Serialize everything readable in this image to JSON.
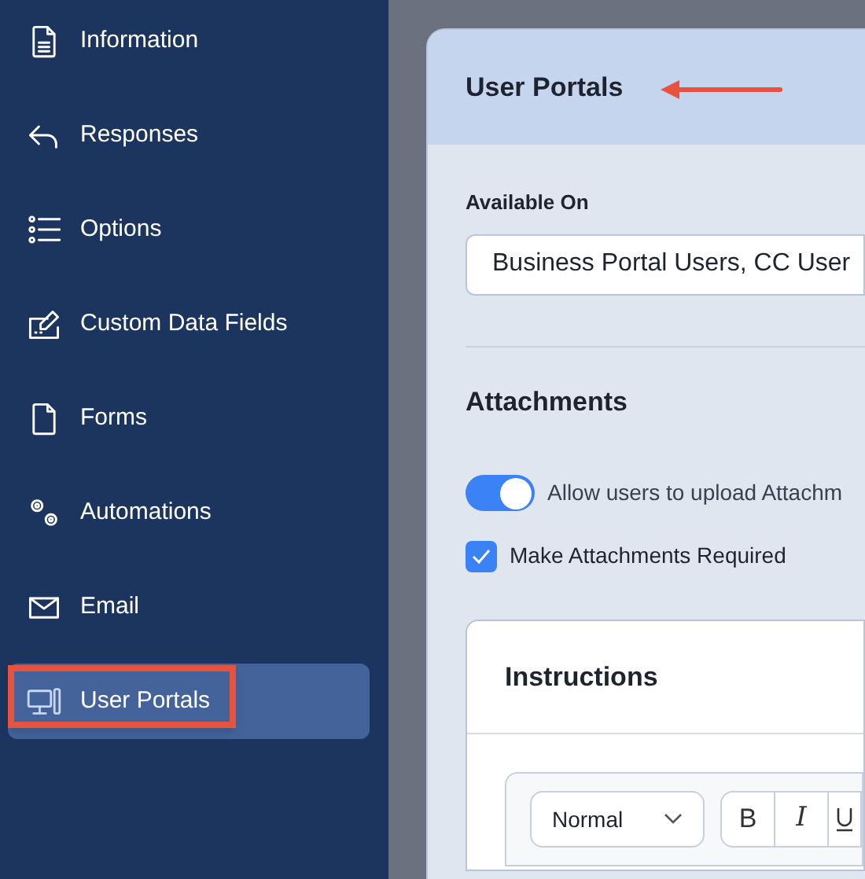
{
  "sidebar": {
    "items": [
      {
        "label": "Information",
        "selected": false
      },
      {
        "label": "Responses",
        "selected": false
      },
      {
        "label": "Options",
        "selected": false
      },
      {
        "label": "Custom Data Fields",
        "selected": false
      },
      {
        "label": "Forms",
        "selected": false
      },
      {
        "label": "Automations",
        "selected": false
      },
      {
        "label": "Email",
        "selected": false
      },
      {
        "label": "User Portals",
        "selected": true
      }
    ]
  },
  "panel": {
    "title": "User Portals",
    "available_on": {
      "label": "Available On",
      "value": "Business Portal Users, CC User"
    },
    "attachments": {
      "heading": "Attachments",
      "toggle": {
        "label": "Allow users to upload Attachm",
        "on": true
      },
      "checkbox": {
        "label": "Make Attachments Required",
        "checked": true
      }
    },
    "instructions": {
      "heading": "Instructions",
      "format_select": "Normal",
      "tools": [
        "B",
        "I"
      ]
    }
  }
}
